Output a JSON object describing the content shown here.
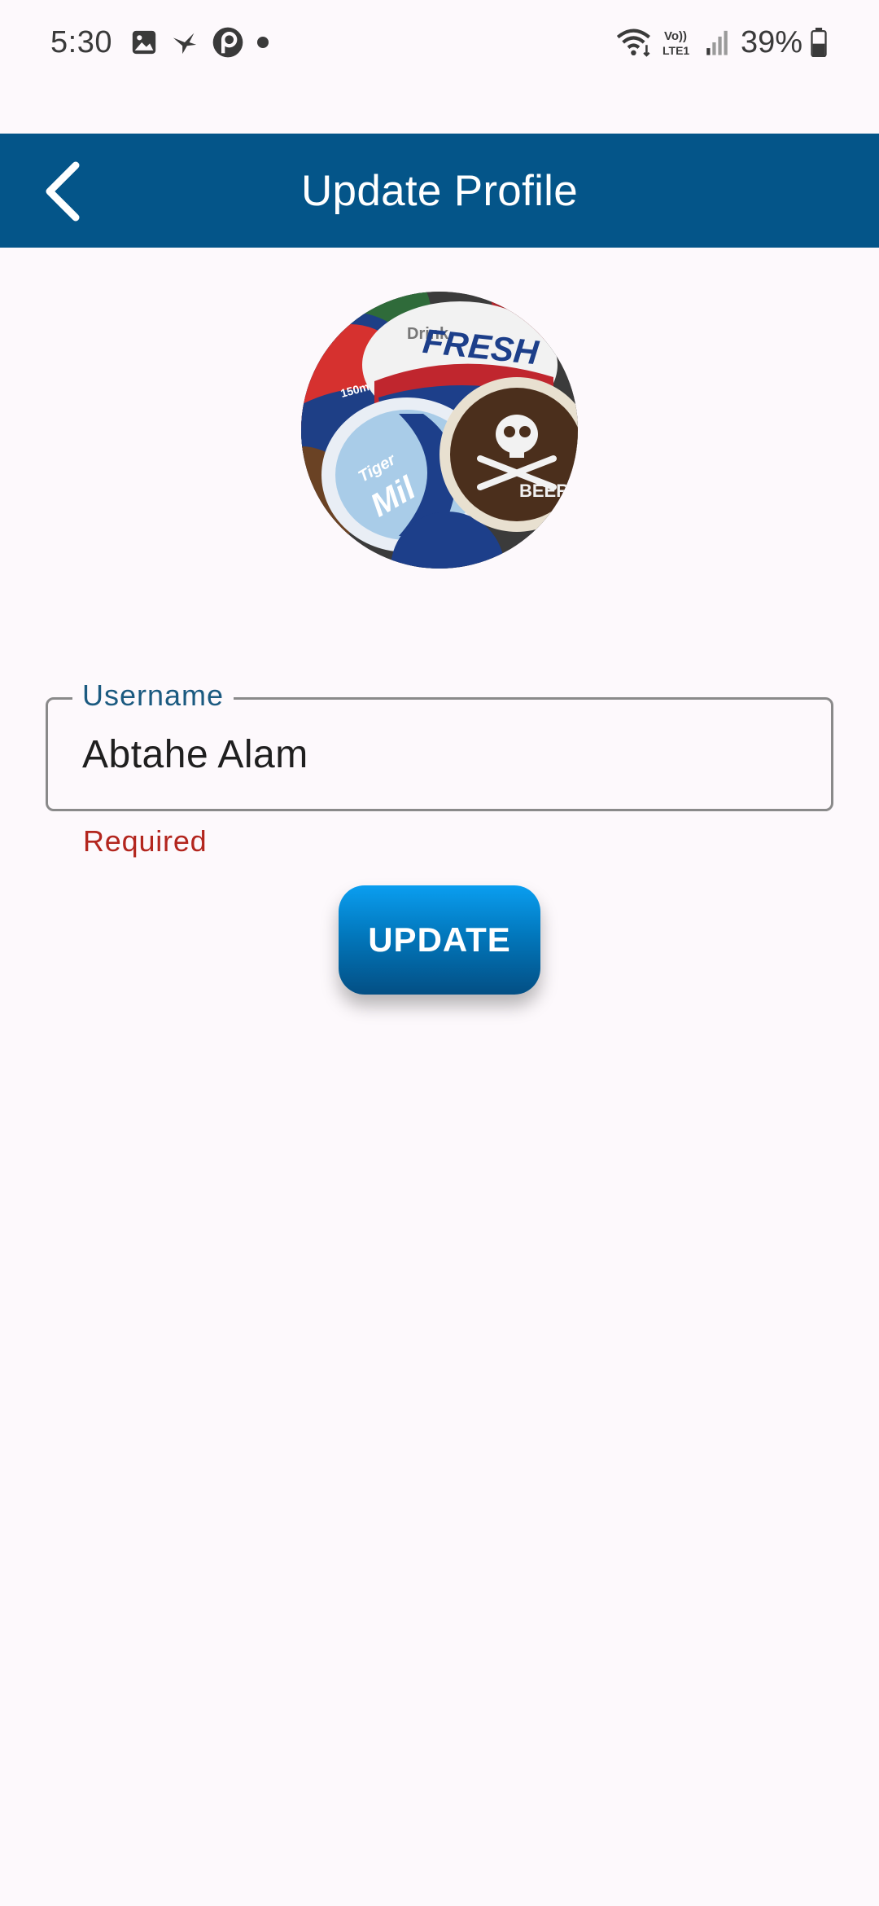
{
  "status_bar": {
    "time": "5:30",
    "battery": "39%",
    "network_label_top": "Vo))",
    "network_label_bottom": "LTE1",
    "left_icons": [
      "gallery-icon",
      "bird-icon",
      "pocket-app-icon",
      "notification-dot-icon"
    ],
    "right_icons": [
      "wifi-icon",
      "volte-icon",
      "signal-icon",
      "battery-icon"
    ]
  },
  "header": {
    "title": "Update Profile",
    "background": "#045589",
    "back_icon": "chevron-left-icon"
  },
  "avatar": {
    "alt": "bottle caps artwork"
  },
  "form": {
    "username_label": "Username",
    "username_value": "Abtahe Alam",
    "error_text": "Required",
    "label_color": "#1b5a80",
    "error_color": "#b3261e"
  },
  "actions": {
    "update_label": "UPDATE",
    "button_color": "#0278bd"
  }
}
